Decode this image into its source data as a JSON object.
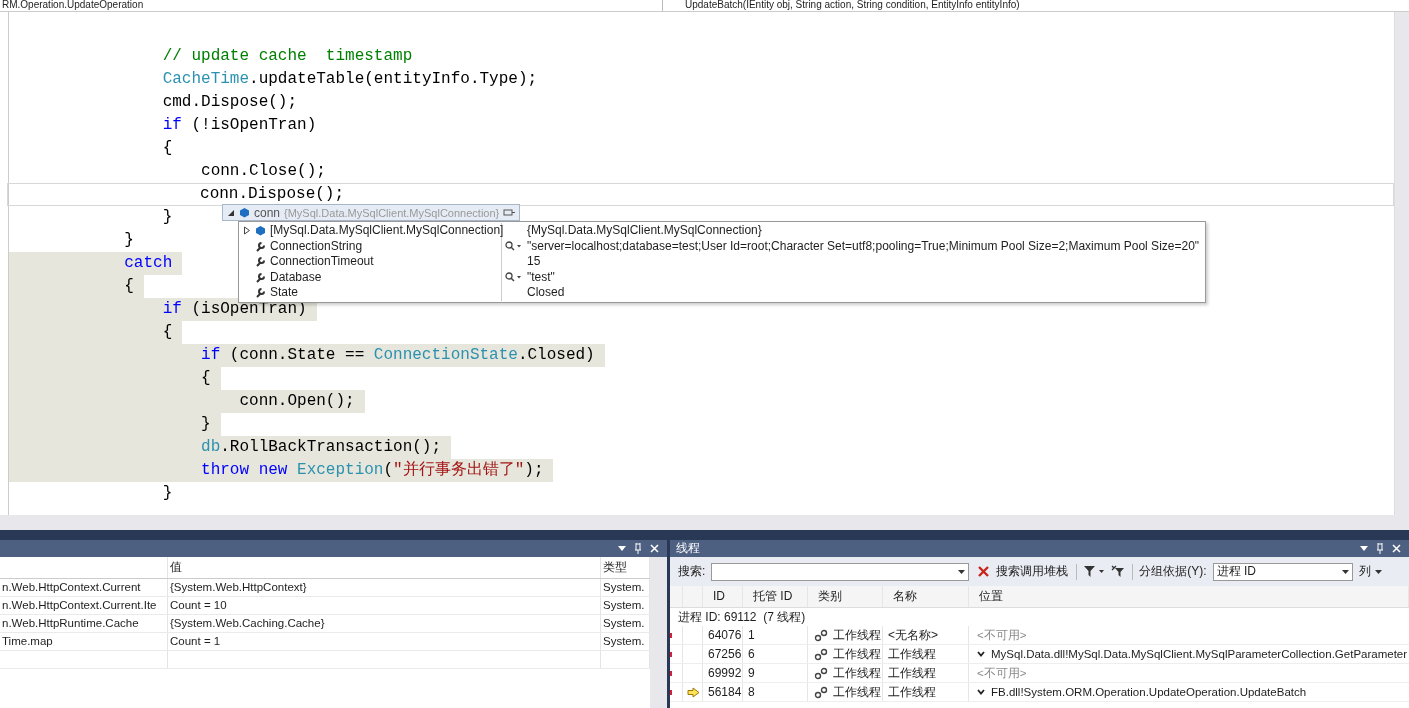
{
  "navigation_bar": {
    "type_dropdown": "RM.Operation.UpdateOperation",
    "member_dropdown": "UpdateBatch(IEntity obj, String action, String condition, EntityInfo entityInfo)"
  },
  "code_lines": [
    {
      "shaded": false,
      "current": false,
      "tokens": [
        {
          "text": "                // update cache  timestamp",
          "kind": "comment"
        }
      ]
    },
    {
      "shaded": false,
      "current": false,
      "tokens": [
        {
          "text": "                CacheTime",
          "kind": "type"
        },
        {
          "text": ".updateTable(entityInfo.Type);",
          "kind": "plain"
        }
      ]
    },
    {
      "shaded": false,
      "current": false,
      "tokens": [
        {
          "text": "                cmd.Dispose();",
          "kind": "plain"
        }
      ]
    },
    {
      "shaded": false,
      "current": false,
      "tokens": [
        {
          "text": "                if",
          "kind": "keyword"
        },
        {
          "text": " (!isOpenTran)",
          "kind": "plain"
        }
      ]
    },
    {
      "shaded": false,
      "current": false,
      "tokens": [
        {
          "text": "                {",
          "kind": "plain"
        }
      ]
    },
    {
      "shaded": false,
      "current": false,
      "tokens": [
        {
          "text": "                    conn.Close();",
          "kind": "plain"
        }
      ]
    },
    {
      "shaded": false,
      "current": true,
      "tokens": [
        {
          "text": "                    conn.Dispose();",
          "kind": "plain"
        }
      ]
    },
    {
      "shaded": false,
      "current": false,
      "tokens": [
        {
          "text": "                }",
          "kind": "plain"
        }
      ]
    },
    {
      "shaded": false,
      "current": false,
      "tokens": [
        {
          "text": "            }",
          "kind": "plain"
        }
      ]
    },
    {
      "shaded": true,
      "current": false,
      "tokens": [
        {
          "text": "            catch",
          "kind": "keyword"
        }
      ]
    },
    {
      "shaded": true,
      "current": false,
      "tokens": [
        {
          "text": "            {",
          "kind": "plain"
        }
      ]
    },
    {
      "shaded": true,
      "current": false,
      "tokens": [
        {
          "text": "                if",
          "kind": "keyword"
        },
        {
          "text": " (isOpenTran)",
          "kind": "plain"
        }
      ]
    },
    {
      "shaded": true,
      "current": false,
      "tokens": [
        {
          "text": "                {",
          "kind": "plain"
        }
      ]
    },
    {
      "shaded": true,
      "current": false,
      "tokens": [
        {
          "text": "                    if",
          "kind": "keyword"
        },
        {
          "text": " (conn.State == ",
          "kind": "plain"
        },
        {
          "text": "ConnectionState",
          "kind": "type"
        },
        {
          "text": ".Closed)",
          "kind": "plain"
        }
      ]
    },
    {
      "shaded": true,
      "current": false,
      "tokens": [
        {
          "text": "                    {",
          "kind": "plain"
        }
      ]
    },
    {
      "shaded": true,
      "current": false,
      "tokens": [
        {
          "text": "                        conn.Open();",
          "kind": "plain"
        }
      ]
    },
    {
      "shaded": true,
      "current": false,
      "tokens": [
        {
          "text": "                    }",
          "kind": "plain"
        }
      ]
    },
    {
      "shaded": true,
      "current": false,
      "tokens": [
        {
          "text": "                    db",
          "kind": "type"
        },
        {
          "text": ".RollBackTransaction();",
          "kind": "plain"
        }
      ]
    },
    {
      "shaded": true,
      "current": false,
      "tokens": [
        {
          "text": "                    throw new",
          "kind": "keyword"
        },
        {
          "text": " Exception",
          "kind": "type"
        },
        {
          "text": "(",
          "kind": "plain"
        },
        {
          "text": "\"并行事务出错了\"",
          "kind": "string"
        },
        {
          "text": ");",
          "kind": "plain"
        }
      ]
    },
    {
      "shaded": false,
      "current": false,
      "tokens": [
        {
          "text": "                }",
          "kind": "plain"
        }
      ]
    }
  ],
  "datatip": {
    "expression": "conn",
    "type": "{MySql.Data.MySqlClient.MySqlConnection}",
    "expanded": true,
    "members": [
      {
        "kind": "base",
        "name": "[MySql.Data.MySqlClient.MySqlConnection]",
        "value": "{MySql.Data.MySqlClient.MySqlConnection}",
        "visualizer": false
      },
      {
        "kind": "property",
        "name": "ConnectionString",
        "value": "\"server=localhost;database=test;User Id=root;Character Set=utf8;pooling=True;Minimum Pool Size=2;Maximum Pool Size=20\"",
        "visualizer": true
      },
      {
        "kind": "property",
        "name": "ConnectionTimeout",
        "value": "15",
        "visualizer": false
      },
      {
        "kind": "property",
        "name": "Database",
        "value": "\"test\"",
        "visualizer": true
      },
      {
        "kind": "property",
        "name": "State",
        "value": "Closed",
        "visualizer": false
      }
    ]
  },
  "watch_panel": {
    "columns": [
      "值",
      "类型"
    ],
    "rows": [
      {
        "name": "n.Web.HttpContext.Current",
        "value": "{System.Web.HttpContext}",
        "type": "System."
      },
      {
        "name": "n.Web.HttpContext.Current.Ite",
        "value": "Count = 10",
        "type": "System."
      },
      {
        "name": "n.Web.HttpRuntime.Cache",
        "value": "{System.Web.Caching.Cache}",
        "type": "System."
      },
      {
        "name": "Time.map",
        "value": "Count = 1",
        "type": "System."
      }
    ]
  },
  "threads_panel": {
    "title": "线程",
    "search_label": "搜索:",
    "search_call_stack": "搜索调用堆栈",
    "group_by_label": "分组依据(Y):",
    "group_by_value": "进程 ID",
    "columns_button": "列",
    "columns": [
      "ID",
      "托管 ID",
      "类别",
      "名称",
      "位置"
    ],
    "group": "进程 ID: 69112  (7 线程)",
    "rows": [
      {
        "id": "64076",
        "managed_id": "1",
        "category": "工作线程",
        "name": "<无名称>",
        "location": "<不可用>",
        "available": false,
        "current": false
      },
      {
        "id": "67256",
        "managed_id": "6",
        "category": "工作线程",
        "name": "工作线程",
        "location": "MySql.Data.dll!MySql.Data.MySqlClient.MySqlParameterCollection.GetParameter",
        "available": true,
        "current": false
      },
      {
        "id": "69992",
        "managed_id": "9",
        "category": "工作线程",
        "name": "工作线程",
        "location": "<不可用>",
        "available": false,
        "current": false
      },
      {
        "id": "56184",
        "managed_id": "8",
        "category": "工作线程",
        "name": "工作线程",
        "location": "FB.dll!System.ORM.Operation.UpdateOperation.UpdateBatch",
        "available": true,
        "current": true
      }
    ]
  }
}
